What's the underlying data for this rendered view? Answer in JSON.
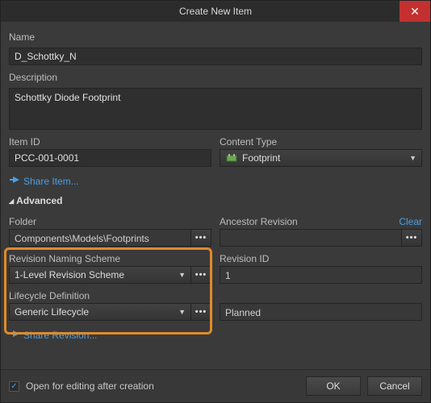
{
  "title": "Create New Item",
  "labels": {
    "name": "Name",
    "description": "Description",
    "itemId": "Item ID",
    "contentType": "Content Type",
    "folder": "Folder",
    "ancestorRevision": "Ancestor Revision",
    "revisionNamingScheme": "Revision Naming Scheme",
    "revisionId": "Revision ID",
    "lifecycleDefinition": "Lifecycle Definition"
  },
  "values": {
    "name": "D_Schottky_N",
    "description": "Schottky Diode Footprint",
    "itemId": "PCC-001-0001",
    "contentType": "Footprint",
    "folder": "Components\\Models\\Footprints",
    "ancestorRevision": "",
    "revisionNamingScheme": "1-Level Revision Scheme",
    "revisionId": "1",
    "lifecycleDefinition": "Generic Lifecycle",
    "lifecycleState": "Planned"
  },
  "links": {
    "shareItem": "Share Item...",
    "shareRevision": "Share Revision...",
    "clear": "Clear"
  },
  "section": {
    "advanced": "Advanced"
  },
  "footer": {
    "openForEdit": "Open for editing after creation",
    "ok": "OK",
    "cancel": "Cancel"
  },
  "glyphs": {
    "ellipsis": "•••",
    "chevronDown": "▼",
    "triangleDown": "◢",
    "check": "✓",
    "close": "✕"
  }
}
